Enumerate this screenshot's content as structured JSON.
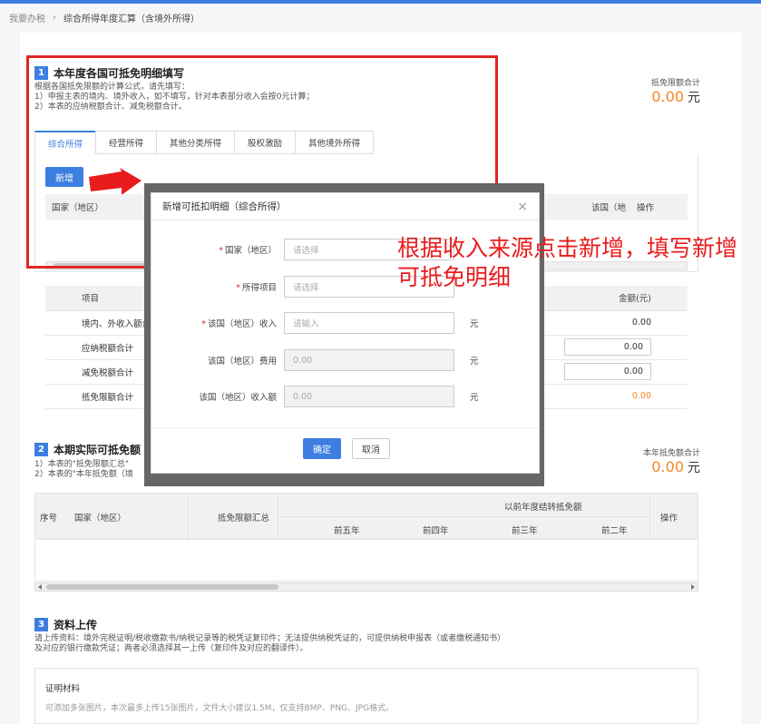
{
  "breadcrumb": {
    "home": "我要办税",
    "sep": "›",
    "current": "综合所得年度汇算（含境外所得）"
  },
  "section1": {
    "number": "1",
    "title": "本年度各国可抵免明细填写",
    "notes": [
      "根据各国抵免限额的计算公式，请先填写：",
      "1）申报主表的境内、境外收入，如不填写，针对本表部分收入会按0元计算；",
      "2）本表的应纳税额合计、减免税额合计。"
    ],
    "tabs": [
      "综合所得",
      "经营所得",
      "其他分类所得",
      "股权激励",
      "其他境外所得"
    ],
    "add_button": "新增",
    "detail_columns": {
      "country": "国家（地区）",
      "right_col": "该国（地",
      "op": "操作"
    },
    "summary_label": "抵免限额合计",
    "summary_value": "0.00",
    "summary_unit": "元",
    "summary_table": {
      "headers": [
        "项目",
        "金额(元)"
      ],
      "rows": [
        {
          "label": "境内、外收入额合",
          "value": "0.00"
        },
        {
          "label": "应纳税额合计",
          "value": "0.00"
        },
        {
          "label": "减免税额合计",
          "value": "0.00"
        },
        {
          "label": "抵免限额合计",
          "value": "0.00"
        }
      ]
    }
  },
  "section2": {
    "number": "2",
    "title": "本期实际可抵免额",
    "notes": [
      "1）本表的\"抵免限额汇总\"",
      "2）本表的\"本年抵免额（境"
    ],
    "summary_label": "本年抵免额合计",
    "summary_value": "0.00",
    "summary_unit": "元",
    "columns": {
      "seq": "序号",
      "country": "国家（地区）",
      "limit_sum": "抵免限额汇总",
      "group": "以前年度结转抵免额",
      "sub": [
        "前五年",
        "前四年",
        "前三年",
        "前二年"
      ],
      "op": "操作"
    }
  },
  "section3": {
    "number": "3",
    "title": "资料上传",
    "notes": [
      "请上传资料：境外完税证明/税收缴款书/纳税记录等的税凭证复印件；无法提供纳税凭证的，可提供纳税申报表（或者缴税通知书）",
      "及对应的银行缴款凭证；两者必须选择其一上传（复印件及对应的翻译件）。"
    ],
    "box_title": "证明材料",
    "box_note": "可添加多张图片，本次最多上传15张图片，文件大小建议1.5M，仅支持BMP、PNG、JPG格式。"
  },
  "dialog": {
    "title": "新增可抵扣明细（综合所得）",
    "close_glyph": "×",
    "fields": [
      {
        "label": "国家（地区）",
        "required": "*",
        "placeholder": "请选择",
        "unit": ""
      },
      {
        "label": "所得项目",
        "required": "*",
        "placeholder": "请选择",
        "unit": ""
      },
      {
        "label": "该国（地区）收入",
        "required": "*",
        "placeholder": "请输入",
        "unit": "元"
      },
      {
        "label": "该国（地区）费用",
        "required": "",
        "placeholder": "0.00",
        "unit": "元"
      },
      {
        "label": "该国（地区）收入额",
        "required": "",
        "placeholder": "0.00",
        "unit": "元"
      }
    ],
    "confirm": "确定",
    "cancel": "取消"
  },
  "annotation": "根据收入来源点击新增，填写新增可抵免明细",
  "colors": {
    "accent": "#3d7fe0",
    "highlight_red": "#e12525",
    "amount_orange": "#f5871f"
  }
}
